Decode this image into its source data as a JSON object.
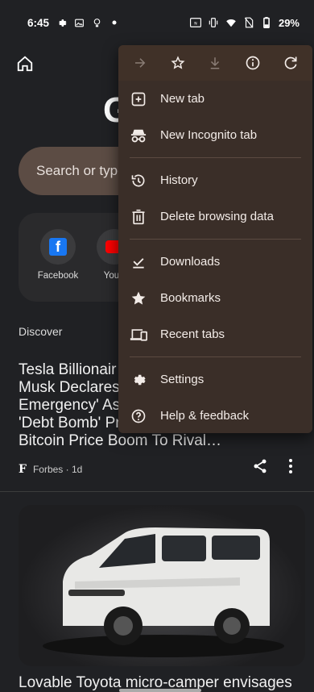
{
  "status_bar": {
    "time": "6:45",
    "battery": "29%",
    "icons": [
      "settings-icon",
      "image-icon",
      "lightbulb-icon",
      "dot-icon",
      "nfc-icon",
      "vibrate-icon",
      "wifi-icon",
      "no-sim-icon",
      "battery-icon"
    ]
  },
  "home": {
    "search_placeholder": "Search or type",
    "shortcuts": [
      {
        "label": "Facebook",
        "icon": "facebook-logo"
      },
      {
        "label": "YouT",
        "icon": "youtube-logo"
      }
    ],
    "discover_label": "Discover"
  },
  "feed": {
    "article1": {
      "title_lines": [
        "Tesla Billionair",
        "Musk Declares",
        "Emergency' As",
        "'Debt Bomb' Pr",
        "Bitcoin Price Boom To Rival…"
      ],
      "source": "Forbes · 1d",
      "source_logo": "F"
    },
    "article2": {
      "title": "Lovable Toyota micro-camper envisages"
    }
  },
  "menu": {
    "toolbar": [
      "forward-icon",
      "bookmark-star-icon",
      "download-icon",
      "info-icon",
      "refresh-icon"
    ],
    "items": [
      {
        "label": "New tab",
        "icon": "new-tab-icon"
      },
      {
        "label": "New Incognito tab",
        "icon": "incognito-icon"
      },
      {
        "label": "History",
        "icon": "history-icon"
      },
      {
        "label": "Delete browsing data",
        "icon": "trash-icon"
      },
      {
        "label": "Downloads",
        "icon": "downloads-icon"
      },
      {
        "label": "Bookmarks",
        "icon": "star-icon"
      },
      {
        "label": "Recent tabs",
        "icon": "devices-icon"
      },
      {
        "label": "Settings",
        "icon": "gear-icon"
      },
      {
        "label": "Help & feedback",
        "icon": "help-icon"
      }
    ]
  },
  "colors": {
    "background": "#202124",
    "menu_bg": "#3a2e28",
    "search_bg": "#5c4c44",
    "text": "#f3ece8"
  }
}
